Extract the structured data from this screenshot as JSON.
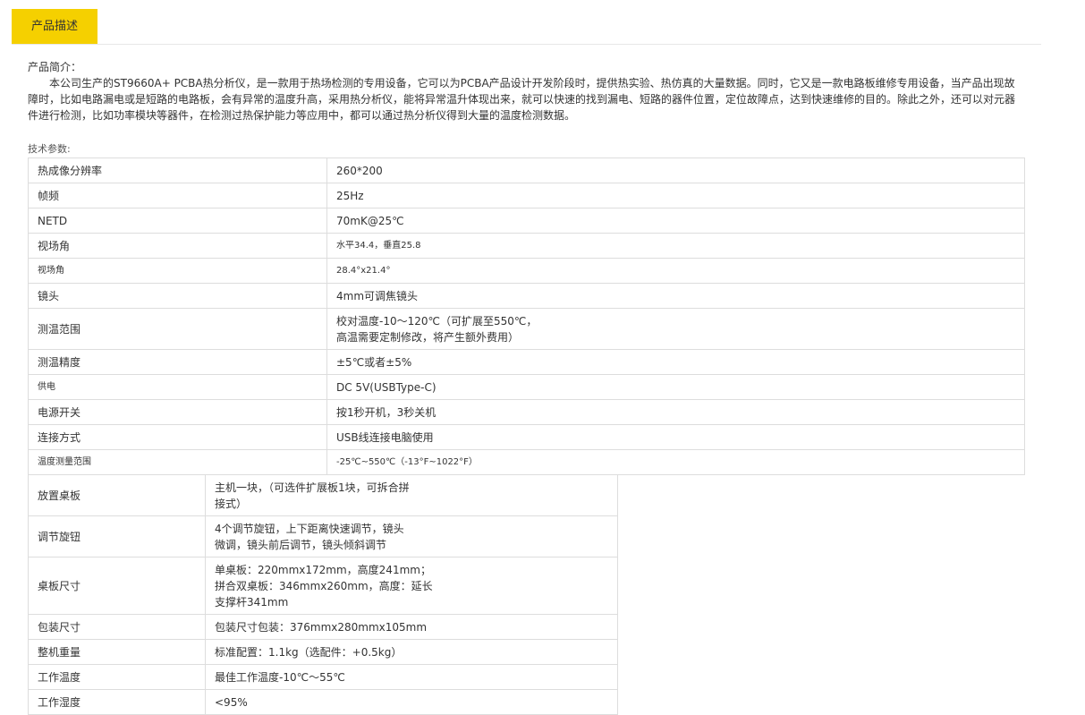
{
  "tabs": {
    "active_label": "产品描述"
  },
  "intro": {
    "heading": "产品简介：",
    "body": "本公司生产的ST9660A+ PCBA热分析仪，是一款用于热场检测的专用设备，它可以为PCBA产品设计开发阶段时，提供热实验、热仿真的大量数据。同时，它又是一款电路板维修专用设备，当产品出现故障时，比如电路漏电或是短路的电路板，会有异常的温度升高，采用热分析仪，能将异常温升体现出来，就可以快速的找到漏电、短路的器件位置，定位故障点，达到快速维修的目的。除此之外，还可以对元器件进行检测，比如功率模块等器件，在检测过热保护能力等应用中，都可以通过热分析仪得到大量的温度检测数据。"
  },
  "specs_label": "技术参数:",
  "spec_table_1": [
    {
      "key": "热成像分辨率",
      "value": "260*200"
    },
    {
      "key": "帧频",
      "value": "25Hz"
    },
    {
      "key": "NETD",
      "value": "70mK@25℃"
    },
    {
      "key": "视场角",
      "value": "水平34.4，垂直25.8"
    },
    {
      "key": "视场角",
      "value": "28.4°x21.4°"
    },
    {
      "key": "镜头",
      "value": "4mm可调焦镜头"
    },
    {
      "key": "测温范围",
      "value": "校对温度-10～120℃（可扩展至550℃，\n高温需要定制修改，将产生额外费用）"
    },
    {
      "key": "测温精度",
      "value": "±5℃或者±5%"
    },
    {
      "key": "供电",
      "value": "DC 5V(USBType-C)"
    },
    {
      "key": "电源开关",
      "value": "按1秒开机，3秒关机"
    },
    {
      "key": "连接方式",
      "value": "USB线连接电脑使用"
    },
    {
      "key": "温度测量范围",
      "value": "-25℃~550℃（-13°F~1022°F）"
    }
  ],
  "spec_table_2": [
    {
      "key": "放置桌板",
      "value": "主机一块，（可选件扩展板1块，可拆合拼\n接式）"
    },
    {
      "key": "调节旋钮",
      "value": "4个调节旋钮，上下距离快速调节，镜头\n微调，镜头前后调节，镜头倾斜调节"
    },
    {
      "key": "桌板尺寸",
      "value": "单桌板：220mmx172mm，高度241mm；\n拼合双桌板：346mmx260mm，高度：延长\n支撑杆341mm"
    },
    {
      "key": "包装尺寸",
      "value": "包装尺寸包装：376mmx280mmx105mm"
    },
    {
      "key": "整机重量",
      "value": "标准配置：1.1kg（选配件：+0.5kg）"
    },
    {
      "key": "工作温度",
      "value": "最佳工作温度-10℃～55℃"
    },
    {
      "key": "工作湿度",
      "value": "<95%"
    }
  ]
}
